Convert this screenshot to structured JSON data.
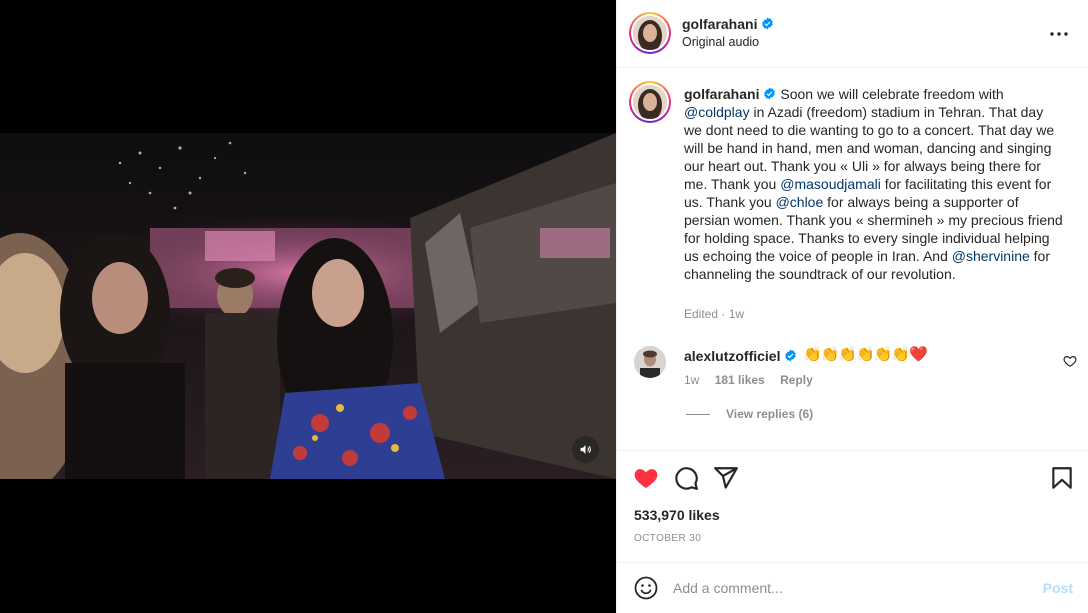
{
  "header": {
    "username": "golfarahani",
    "audio_label": "Original audio"
  },
  "caption": {
    "username": "golfarahani",
    "parts": {
      "t1": "Soon we will celebrate freedom with",
      "m1": "@coldplay",
      "t2": "in Azadi (freedom) stadium in Tehran. That day we dont need to die wanting to go to a concert. That day we will be hand in hand, men and woman, dancing and singing our heart out. Thank you « Uli » for always being there for me. Thank you",
      "m2": "@masoudjamali",
      "t3": "for facilitating this event for us. Thank you",
      "m3": "@chloe",
      "t4": "for always being a supporter of persian women. Thank you « shermineh » my precious friend for holding space. Thanks to every single individual helping us echoing the voice of people in Iran. And",
      "m4": "@shervinine",
      "t5": "for channeling the soundtrack of our revolution."
    },
    "edited": "Edited",
    "dot": "·",
    "time": "1w"
  },
  "comment": {
    "username": "alexlutzofficiel",
    "text": "👏👏👏👏👏👏❤️",
    "time": "1w",
    "likes": "181 likes",
    "reply": "Reply",
    "view_replies": "View replies (6)"
  },
  "actions": {
    "likes": "533,970 likes",
    "date": "OCTOBER 30",
    "liked": true,
    "like_color": "#ff3040"
  },
  "add_comment": {
    "placeholder": "Add a comment...",
    "post_label": "Post"
  },
  "colors": {
    "verified": "#0095f6",
    "mention": "#00376b",
    "post_disabled": "#b2dffc"
  }
}
